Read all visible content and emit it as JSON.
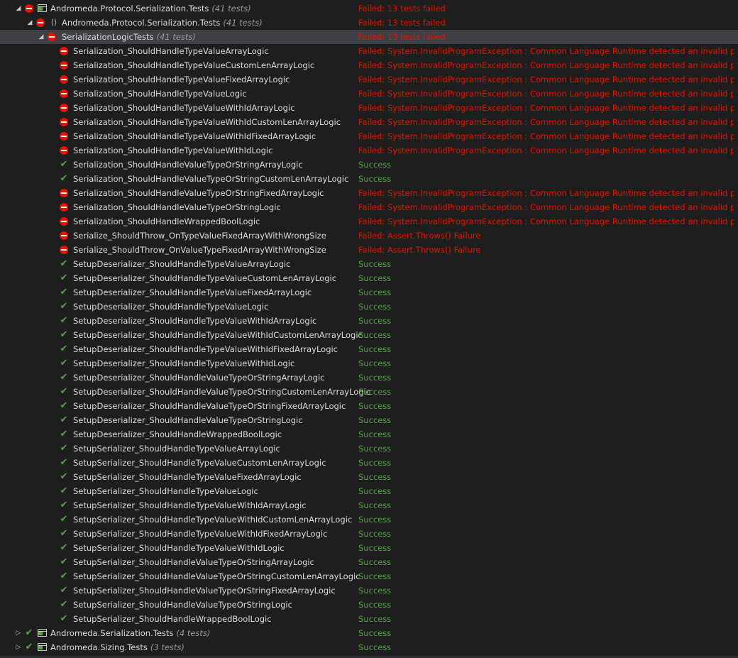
{
  "colors": {
    "background": "#1e1e1e",
    "failed": "#e51400",
    "success": "#57a64a",
    "selected_row": "#3f3f46"
  },
  "tree": {
    "root": {
      "name": "Andromeda.Protocol.Serialization.Tests",
      "count": "(41 tests)",
      "message": "Failed: 13 tests failed",
      "icon": "project-icon",
      "status": "failed"
    },
    "namespace": {
      "name": "Andromeda.Protocol.Serialization.Tests",
      "count": "(41 tests)",
      "message": "Failed: 13 tests failed",
      "icon": "namespace-icon",
      "status": "failed"
    },
    "class": {
      "name": "SerializationLogicTests",
      "count": "(41 tests)",
      "message": "Failed: 13 tests failed",
      "status": "failed"
    },
    "tests": [
      {
        "name": "Serialization_ShouldHandleTypeValueArrayLogic",
        "message": "Failed: System.InvalidProgramException : Common Language Runtime detected an invalid program.",
        "status": "failed"
      },
      {
        "name": "Serialization_ShouldHandleTypeValueCustomLenArrayLogic",
        "message": "Failed: System.InvalidProgramException : Common Language Runtime detected an invalid program.",
        "status": "failed"
      },
      {
        "name": "Serialization_ShouldHandleTypeValueFixedArrayLogic",
        "message": "Failed: System.InvalidProgramException : Common Language Runtime detected an invalid program.",
        "status": "failed"
      },
      {
        "name": "Serialization_ShouldHandleTypeValueLogic",
        "message": "Failed: System.InvalidProgramException : Common Language Runtime detected an invalid program.",
        "status": "failed"
      },
      {
        "name": "Serialization_ShouldHandleTypeValueWithIdArrayLogic",
        "message": "Failed: System.InvalidProgramException : Common Language Runtime detected an invalid program.",
        "status": "failed"
      },
      {
        "name": "Serialization_ShouldHandleTypeValueWithIdCustomLenArrayLogic",
        "message": "Failed: System.InvalidProgramException : Common Language Runtime detected an invalid program.",
        "status": "failed"
      },
      {
        "name": "Serialization_ShouldHandleTypeValueWithIdFixedArrayLogic",
        "message": "Failed: System.InvalidProgramException : Common Language Runtime detected an invalid program.",
        "status": "failed"
      },
      {
        "name": "Serialization_ShouldHandleTypeValueWithIdLogic",
        "message": "Failed: System.InvalidProgramException : Common Language Runtime detected an invalid program.",
        "status": "failed"
      },
      {
        "name": "Serialization_ShouldHandleValueTypeOrStringArrayLogic",
        "message": "Success",
        "status": "passed"
      },
      {
        "name": "Serialization_ShouldHandleValueTypeOrStringCustomLenArrayLogic",
        "message": "Success",
        "status": "passed"
      },
      {
        "name": "Serialization_ShouldHandleValueTypeOrStringFixedArrayLogic",
        "message": "Failed: System.InvalidProgramException : Common Language Runtime detected an invalid program.",
        "status": "failed"
      },
      {
        "name": "Serialization_ShouldHandleValueTypeOrStringLogic",
        "message": "Failed: System.InvalidProgramException : Common Language Runtime detected an invalid program.",
        "status": "failed"
      },
      {
        "name": "Serialization_ShouldHandleWrappedBoolLogic",
        "message": "Failed: System.InvalidProgramException : Common Language Runtime detected an invalid program.",
        "status": "failed"
      },
      {
        "name": "Serialize_ShouldThrow_OnTypeValueFixedArrayWithWrongSize",
        "message": "Failed: Assert.Throws() Failure",
        "status": "failed"
      },
      {
        "name": "Serialize_ShouldThrow_OnValueTypeFixedArrayWithWrongSize",
        "message": "Failed: Assert.Throws() Failure",
        "status": "failed"
      },
      {
        "name": "SetupDeserializer_ShouldHandleTypeValueArrayLogic",
        "message": "Success",
        "status": "passed"
      },
      {
        "name": "SetupDeserializer_ShouldHandleTypeValueCustomLenArrayLogic",
        "message": "Success",
        "status": "passed"
      },
      {
        "name": "SetupDeserializer_ShouldHandleTypeValueFixedArrayLogic",
        "message": "Success",
        "status": "passed"
      },
      {
        "name": "SetupDeserializer_ShouldHandleTypeValueLogic",
        "message": "Success",
        "status": "passed"
      },
      {
        "name": "SetupDeserializer_ShouldHandleTypeValueWithIdArrayLogic",
        "message": "Success",
        "status": "passed"
      },
      {
        "name": "SetupDeserializer_ShouldHandleTypeValueWithIdCustomLenArrayLogic",
        "message": "Success",
        "status": "passed"
      },
      {
        "name": "SetupDeserializer_ShouldHandleTypeValueWithIdFixedArrayLogic",
        "message": "Success",
        "status": "passed"
      },
      {
        "name": "SetupDeserializer_ShouldHandleTypeValueWithIdLogic",
        "message": "Success",
        "status": "passed"
      },
      {
        "name": "SetupDeserializer_ShouldHandleValueTypeOrStringArrayLogic",
        "message": "Success",
        "status": "passed"
      },
      {
        "name": "SetupDeserializer_ShouldHandleValueTypeOrStringCustomLenArrayLogic",
        "message": "Success",
        "status": "passed"
      },
      {
        "name": "SetupDeserializer_ShouldHandleValueTypeOrStringFixedArrayLogic",
        "message": "Success",
        "status": "passed"
      },
      {
        "name": "SetupDeserializer_ShouldHandleValueTypeOrStringLogic",
        "message": "Success",
        "status": "passed"
      },
      {
        "name": "SetupDeserializer_ShouldHandleWrappedBoolLogic",
        "message": "Success",
        "status": "passed"
      },
      {
        "name": "SetupSerializer_ShouldHandleTypeValueArrayLogic",
        "message": "Success",
        "status": "passed"
      },
      {
        "name": "SetupSerializer_ShouldHandleTypeValueCustomLenArrayLogic",
        "message": "Success",
        "status": "passed"
      },
      {
        "name": "SetupSerializer_ShouldHandleTypeValueFixedArrayLogic",
        "message": "Success",
        "status": "passed"
      },
      {
        "name": "SetupSerializer_ShouldHandleTypeValueLogic",
        "message": "Success",
        "status": "passed"
      },
      {
        "name": "SetupSerializer_ShouldHandleTypeValueWithIdArrayLogic",
        "message": "Success",
        "status": "passed"
      },
      {
        "name": "SetupSerializer_ShouldHandleTypeValueWithIdCustomLenArrayLogic",
        "message": "Success",
        "status": "passed"
      },
      {
        "name": "SetupSerializer_ShouldHandleTypeValueWithIdFixedArrayLogic",
        "message": "Success",
        "status": "passed"
      },
      {
        "name": "SetupSerializer_ShouldHandleTypeValueWithIdLogic",
        "message": "Success",
        "status": "passed"
      },
      {
        "name": "SetupSerializer_ShouldHandleValueTypeOrStringArrayLogic",
        "message": "Success",
        "status": "passed"
      },
      {
        "name": "SetupSerializer_ShouldHandleValueTypeOrStringCustomLenArrayLogic",
        "message": "Success",
        "status": "passed"
      },
      {
        "name": "SetupSerializer_ShouldHandleValueTypeOrStringFixedArrayLogic",
        "message": "Success",
        "status": "passed"
      },
      {
        "name": "SetupSerializer_ShouldHandleValueTypeOrStringLogic",
        "message": "Success",
        "status": "passed"
      },
      {
        "name": "SetupSerializer_ShouldHandleWrappedBoolLogic",
        "message": "Success",
        "status": "passed"
      }
    ],
    "other_projects": [
      {
        "name": "Andromeda.Serialization.Tests",
        "count": "(4 tests)",
        "message": "Success",
        "status": "passed",
        "icon": "project-icon"
      },
      {
        "name": "Andromeda.Sizing.Tests",
        "count": "(3 tests)",
        "message": "Success",
        "status": "passed",
        "icon": "project-icon"
      }
    ]
  }
}
